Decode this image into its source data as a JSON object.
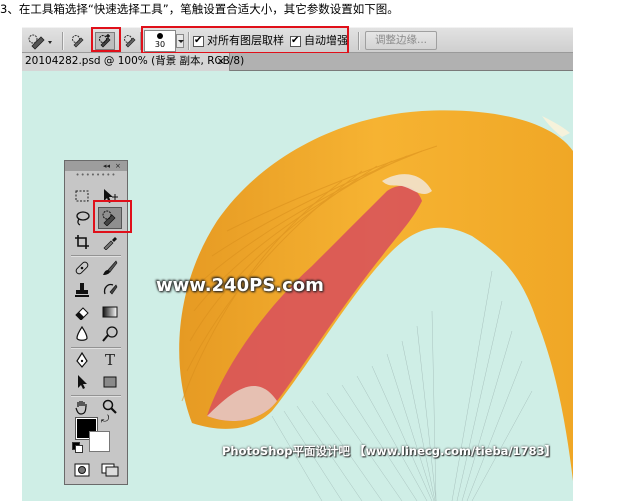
{
  "caption": "3、在工具箱选择“快速选择工具”，笔触设置合适大小，其它参数设置如下图。",
  "options_bar": {
    "brush_size": "30",
    "sample_all_layers_label": "对所有图层取样",
    "auto_enhance_label": "自动增强",
    "refine_edge_label": "调整边缘...",
    "sample_all_layers_checked": true,
    "auto_enhance_checked": true
  },
  "document": {
    "tab_title": "20104282.psd @ 100% (背景 副本, RGB/8)",
    "tab_close": "×"
  },
  "tools_panel": {
    "collapse_glyph": "◂◂",
    "close_glyph": "×",
    "grip": "••••••••"
  },
  "canvas": {
    "watermark": "www.240PS.com",
    "credit": "PhotoShop平面设计吧 【www.linecg.com/tieba/1783】"
  },
  "colors": {
    "highlight": "#e0101a",
    "canvas_bg": "#cfeee6",
    "wing_orange": "#f3ac2c",
    "wing_red": "#d9535a",
    "foreground": "#000000",
    "background": "#ffffff"
  }
}
